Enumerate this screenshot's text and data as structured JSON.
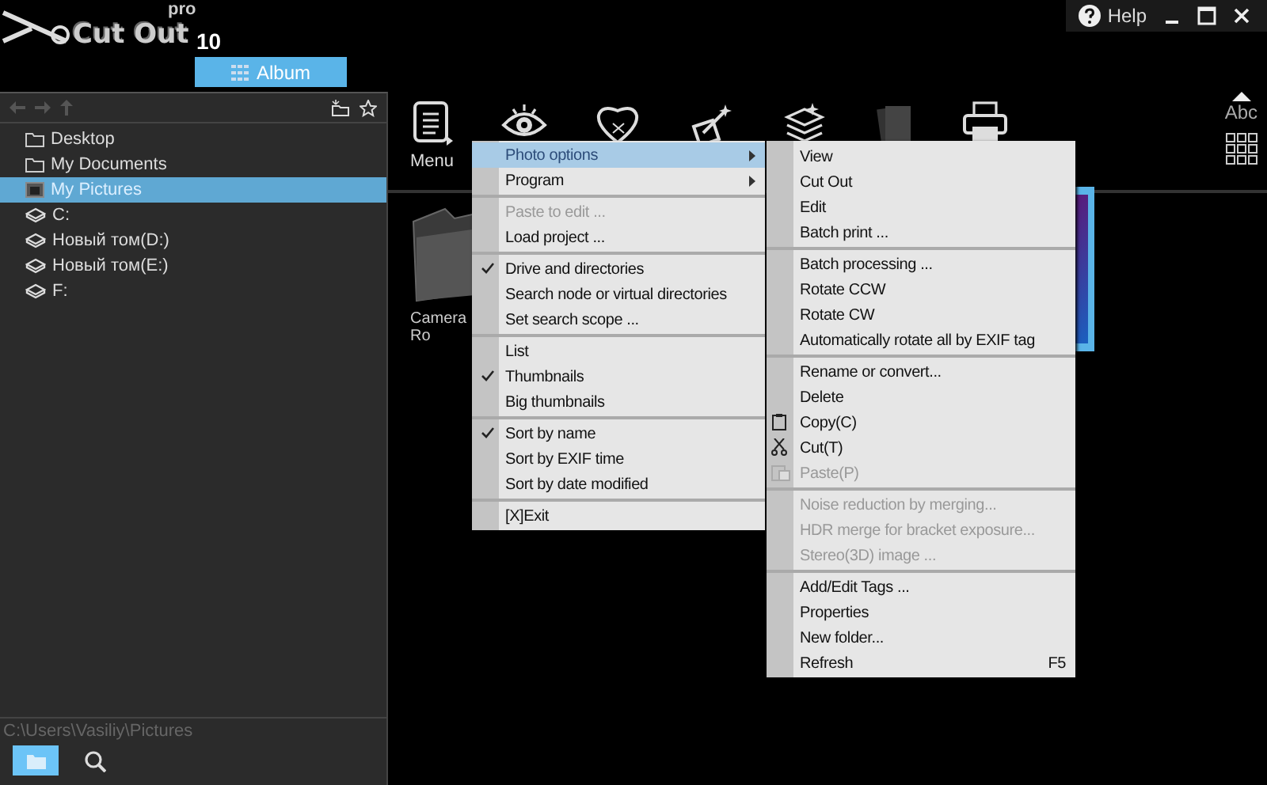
{
  "logo": {
    "name": "Cut Out",
    "edition": "pro",
    "version": "10"
  },
  "window_controls": {
    "help": "Help"
  },
  "album_tab": {
    "label": "Album",
    "selected": true
  },
  "sidebar": {
    "items": [
      {
        "label": "Desktop",
        "kind": "folder",
        "selected": false
      },
      {
        "label": "My Documents",
        "kind": "folder",
        "selected": false
      },
      {
        "label": "My Pictures",
        "kind": "pictures",
        "selected": true
      },
      {
        "label": "C:",
        "kind": "drive",
        "selected": false
      },
      {
        "label": "Новый том(D:)",
        "kind": "drive",
        "selected": false
      },
      {
        "label": "Новый том(E:)",
        "kind": "drive",
        "selected": false
      },
      {
        "label": "F:",
        "kind": "drive",
        "selected": false
      }
    ],
    "path": "C:\\Users\\Vasiliy\\Pictures",
    "buttons": [
      {
        "kind": "folder",
        "selected": true
      },
      {
        "kind": "search",
        "selected": false
      }
    ]
  },
  "toolbar": {
    "items": [
      {
        "kind": "menu",
        "label": "Menu"
      },
      {
        "kind": "eye"
      },
      {
        "kind": "heart"
      },
      {
        "kind": "wand"
      },
      {
        "kind": "stack"
      },
      {
        "kind": "cards"
      },
      {
        "kind": "printer"
      }
    ],
    "sort_label": "Abc"
  },
  "thumbnails": [
    {
      "kind": "folder",
      "label": "Camera Ro"
    },
    {
      "kind": "photo",
      "selected": true
    }
  ],
  "context_menu": {
    "groups": [
      [
        {
          "label": "Photo options",
          "submenu": true,
          "selected": true,
          "checked": false,
          "disabled": false
        },
        {
          "label": "Program",
          "submenu": true,
          "selected": false,
          "checked": false,
          "disabled": false
        }
      ],
      [
        {
          "label": "Paste to edit ...",
          "submenu": false,
          "selected": false,
          "checked": false,
          "disabled": true
        },
        {
          "label": "Load project ...",
          "submenu": false,
          "selected": false,
          "checked": false,
          "disabled": false
        }
      ],
      [
        {
          "label": "Drive and directories",
          "submenu": false,
          "selected": false,
          "checked": true,
          "disabled": false
        },
        {
          "label": "Search node or virtual directories",
          "submenu": false,
          "selected": false,
          "checked": false,
          "disabled": false
        },
        {
          "label": "Set search scope ...",
          "submenu": false,
          "selected": false,
          "checked": false,
          "disabled": false
        }
      ],
      [
        {
          "label": "List",
          "submenu": false,
          "selected": false,
          "checked": false,
          "disabled": false
        },
        {
          "label": "Thumbnails",
          "submenu": false,
          "selected": false,
          "checked": true,
          "disabled": false
        },
        {
          "label": "Big thumbnails",
          "submenu": false,
          "selected": false,
          "checked": false,
          "disabled": false
        }
      ],
      [
        {
          "label": "Sort by name",
          "submenu": false,
          "selected": false,
          "checked": true,
          "disabled": false
        },
        {
          "label": "Sort by EXIF time",
          "submenu": false,
          "selected": false,
          "checked": false,
          "disabled": false
        },
        {
          "label": "Sort by date modified",
          "submenu": false,
          "selected": false,
          "checked": false,
          "disabled": false
        }
      ],
      [
        {
          "label": "[X]Exit",
          "submenu": false,
          "selected": false,
          "checked": false,
          "disabled": false
        }
      ]
    ]
  },
  "submenu": {
    "groups": [
      [
        {
          "label": "View",
          "disabled": false
        },
        {
          "label": "Cut Out",
          "disabled": false
        },
        {
          "label": "Edit",
          "disabled": false
        },
        {
          "label": "Batch print ...",
          "disabled": false
        }
      ],
      [
        {
          "label": "Batch processing ...",
          "disabled": false
        },
        {
          "label": "Rotate CCW",
          "disabled": false
        },
        {
          "label": "Rotate CW",
          "disabled": false
        },
        {
          "label": "Automatically rotate all by EXIF tag",
          "disabled": false
        }
      ],
      [
        {
          "label": "Rename or convert...",
          "disabled": false
        },
        {
          "label": "Delete",
          "disabled": false
        },
        {
          "label": "Copy(C)",
          "kind": "copy",
          "disabled": false
        },
        {
          "label": "Cut(T)",
          "kind": "scissors",
          "disabled": false
        },
        {
          "label": "Paste(P)",
          "kind": "paste",
          "disabled": true
        }
      ],
      [
        {
          "label": "Noise reduction by merging...",
          "disabled": true
        },
        {
          "label": "HDR merge for bracket exposure...",
          "disabled": true
        },
        {
          "label": "Stereo(3D) image ...",
          "disabled": true
        }
      ],
      [
        {
          "label": "Add/Edit Tags ...",
          "disabled": false
        },
        {
          "label": "Properties",
          "disabled": false
        },
        {
          "label": "New folder...",
          "disabled": false
        },
        {
          "label": "Refresh",
          "shortcut": "F5",
          "disabled": false
        }
      ]
    ]
  }
}
